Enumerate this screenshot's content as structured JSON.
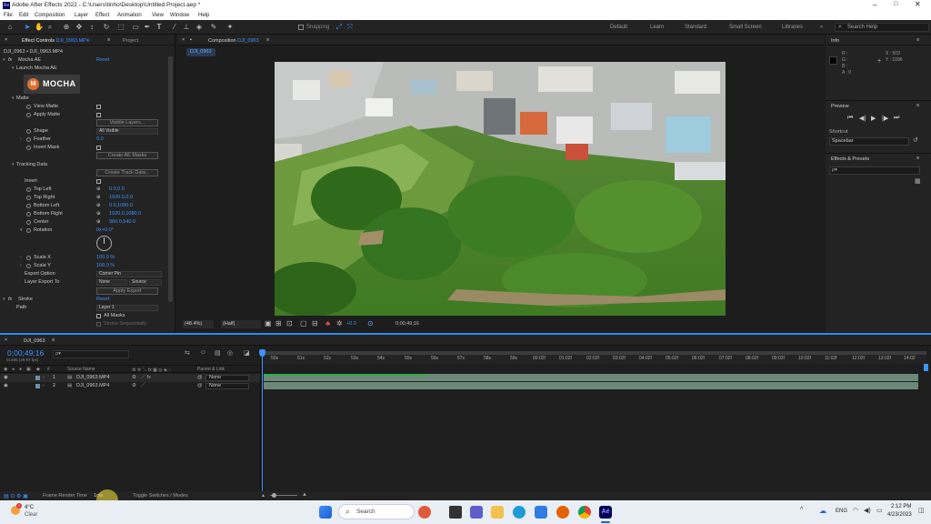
{
  "window": {
    "title": "Adobe After Effects 2022 - C:\\Users\\tinho\\Desktop\\Untitled Project.aep *",
    "app_badge": "Ae"
  },
  "menu": [
    "File",
    "Edit",
    "Composition",
    "Layer",
    "Effect",
    "Animation",
    "View",
    "Window",
    "Help"
  ],
  "toolbar": {
    "snapping": "Snapping",
    "workspaces": [
      "Default",
      "Learn",
      "Standard",
      "Small Screen",
      "Libraries"
    ],
    "search_placeholder": "Search Help",
    "more": "»"
  },
  "left_panel": {
    "tab_effect": "Effect Controls",
    "tab_effect_layer": "DJI_0963.MP4",
    "tab_project": "Project",
    "header": "DJI_0963 • DJI_0963.MP4",
    "mocha": {
      "name": "Mocha AE",
      "reset": "Reset",
      "launch": "Launch Mocha AE",
      "logo": "MOCHA",
      "logo_letter": "M"
    },
    "matte_group": "Matte",
    "view_matte": "View Matte",
    "apply_matte": "Apply Matte",
    "visible_layers": "Visible Layers...",
    "shape": "Shape",
    "shape_val": "All Visible",
    "feather": "Feather",
    "feather_val": "0.0",
    "invert_mask": "Invert Mask",
    "create_ae_masks": "Create AE Masks",
    "tracking_group": "Tracking Data",
    "create_track_data": "Create Track Data...",
    "invert": "Invert",
    "top_left": "Top Left",
    "top_left_val": "0.0,0.0",
    "top_right": "Top Right",
    "top_right_val": "1920.0,0.0",
    "bottom_left": "Bottom Left",
    "bottom_left_val": "0.0,1080.0",
    "bottom_right": "Bottom Right",
    "bottom_right_val": "1920.0,1080.0",
    "center": "Center",
    "center_val": "960.0,540.0",
    "rotation": "Rotation",
    "rotation_val": "0x+0.0°",
    "scale_x": "Scale X",
    "scale_x_val": "100.0 %",
    "scale_y": "Scale Y",
    "scale_y_val": "100.0 %",
    "export_option": "Export Option",
    "export_option_val": "Corner Pin",
    "layer_export_to": "Layer Export To",
    "layer_export_val": "None",
    "source_val": "Source",
    "apply_export": "Apply Export",
    "stroke": "Stroke",
    "stroke_reset": "Reset",
    "path": "Path",
    "path_val": "Layer 1",
    "all_masks": "All Masks",
    "stroke_seq": "Stroke Sequentially"
  },
  "composition": {
    "tab": "Composition",
    "tab_name": "DJI_0963",
    "more": "≡",
    "breadcrumb": "DJI_0963",
    "zoom": "(48.4%)",
    "quality": "(Half)",
    "exposure": "+0.0",
    "timecode": "0;00;49;16"
  },
  "right_panel": {
    "info": "Info",
    "rgb": [
      "R :",
      "G :",
      "B :",
      "A : 0"
    ],
    "x": "X : 503",
    "y": "Y : 1096",
    "preview": "Preview",
    "shortcut": "Shortcut",
    "shortcut_val": "Spacebar",
    "effects_presets": "Effects & Presets",
    "search_ph": "ρ▾"
  },
  "timeline": {
    "tab": "DJI_0963",
    "timecode": "0;00;49;16",
    "frames": "01486 (29.97 fps)",
    "search_ph": "ρ▾",
    "col_source": "Source Name",
    "col_parent": "Parent & Link",
    "layers": [
      {
        "num": "1",
        "name": "DJI_0963.MP4",
        "parent": "None"
      },
      {
        "num": "2",
        "name": "DJI_0963.MP4",
        "parent": "None"
      }
    ],
    "ruler": [
      "50s",
      "51s",
      "52s",
      "53s",
      "54s",
      "55s",
      "56s",
      "57s",
      "58s",
      "59s",
      "00:02f",
      "01:02f",
      "02:02f",
      "03:02f",
      "04:02f",
      "05:02f",
      "06:02f",
      "07:02f",
      "08:02f",
      "09:02f",
      "10:02f",
      "11:02f",
      "12:02f",
      "13:02f",
      "14:02"
    ]
  },
  "status": {
    "frame_render": "Frame Render Time",
    "render_val": "1ms",
    "toggle": "Toggle Switches / Modes"
  },
  "taskbar": {
    "weather_temp": "4°C",
    "weather_desc": "Clear",
    "search": "Search",
    "lang": "ENG",
    "time": "2:12 PM",
    "date": "4/23/2023",
    "notif": "1"
  },
  "colors": {
    "accent": "#2d8ceb",
    "value_blue": "#3a93ff",
    "panel": "#232323"
  }
}
